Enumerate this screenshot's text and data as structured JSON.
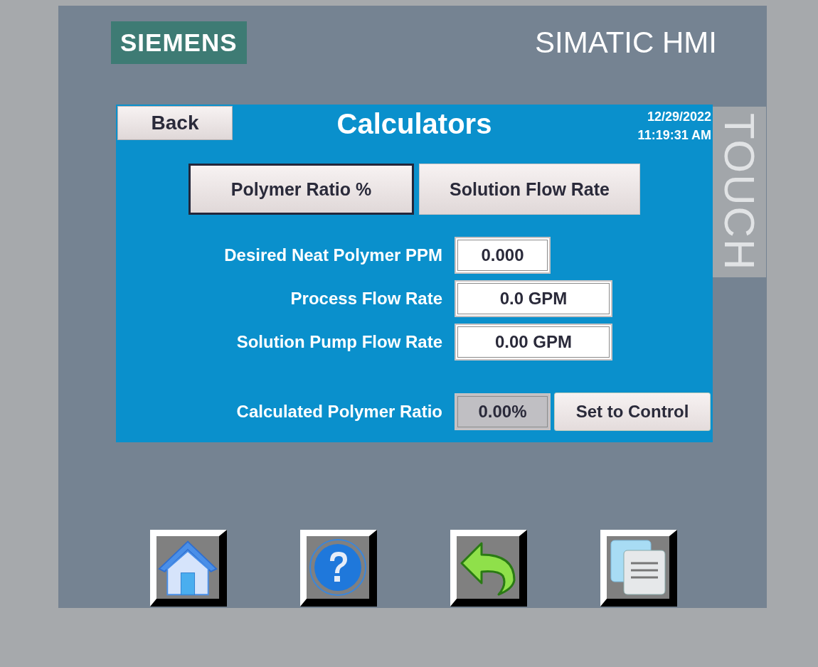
{
  "brand": {
    "logo": "SIEMENS",
    "product": "SIMATIC HMI",
    "panel_label": "TOUCH"
  },
  "screen": {
    "back_button": "Back",
    "title": "Calculators",
    "date": "12/29/2022",
    "time": "11:19:31 AM",
    "tabs": [
      {
        "label": "Polymer Ratio %",
        "selected": true
      },
      {
        "label": "Solution Flow Rate",
        "selected": false
      }
    ],
    "fields": [
      {
        "label": "Desired Neat Polymer PPM",
        "value": "0.000",
        "kind": "input"
      },
      {
        "label": "Process Flow Rate",
        "value": "0.0 GPM",
        "kind": "input"
      },
      {
        "label": "Solution Pump Flow Rate",
        "value": "0.00 GPM",
        "kind": "input"
      },
      {
        "label": "Calculated Polymer Ratio",
        "value": "0.00%",
        "kind": "output",
        "action": "Set to Control"
      }
    ]
  }
}
